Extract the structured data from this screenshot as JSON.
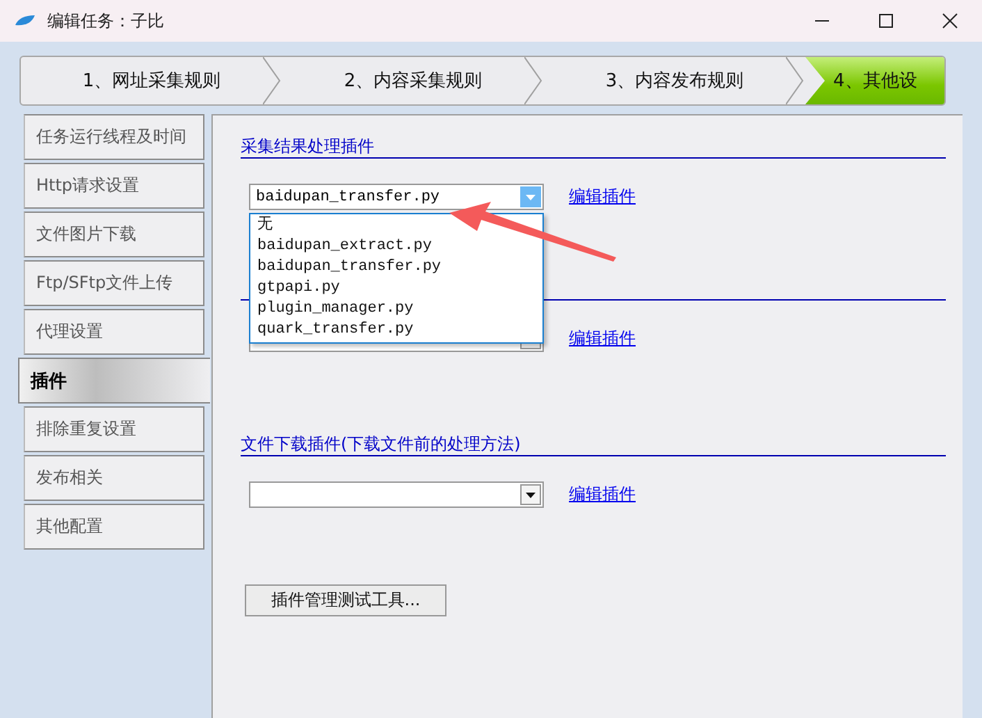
{
  "window": {
    "title": "编辑任务：子比"
  },
  "steps": [
    {
      "label": "1、网址采集规则",
      "selected": false
    },
    {
      "label": "2、内容采集规则",
      "selected": false
    },
    {
      "label": "3、内容发布规则",
      "selected": false
    },
    {
      "label": "4、其他设",
      "selected": true
    }
  ],
  "sidebar": {
    "items": [
      {
        "label": "任务运行线程及时间",
        "selected": false
      },
      {
        "label": "Http请求设置",
        "selected": false
      },
      {
        "label": "文件图片下载",
        "selected": false
      },
      {
        "label": "Ftp/SFtp文件上传",
        "selected": false
      },
      {
        "label": "代理设置",
        "selected": false
      },
      {
        "label": "插件",
        "selected": true
      },
      {
        "label": "排除重复设置",
        "selected": false
      },
      {
        "label": "发布相关",
        "selected": false
      },
      {
        "label": "其他配置",
        "selected": false
      }
    ]
  },
  "sections": [
    {
      "title": "采集结果处理插件",
      "value": "baidupan_transfer.py",
      "link": "编辑插件",
      "open": true
    },
    {
      "link": "编辑插件",
      "open": false
    },
    {
      "title": "文件下载插件(下载文件前的处理方法)",
      "link": "编辑插件",
      "open": false
    }
  ],
  "dropdown": {
    "options": [
      "无",
      "baidupan_extract.py",
      "baidupan_transfer.py",
      "gtpapi.py",
      "plugin_manager.py",
      "quark_transfer.py"
    ]
  },
  "button": {
    "label": "插件管理测试工具..."
  }
}
